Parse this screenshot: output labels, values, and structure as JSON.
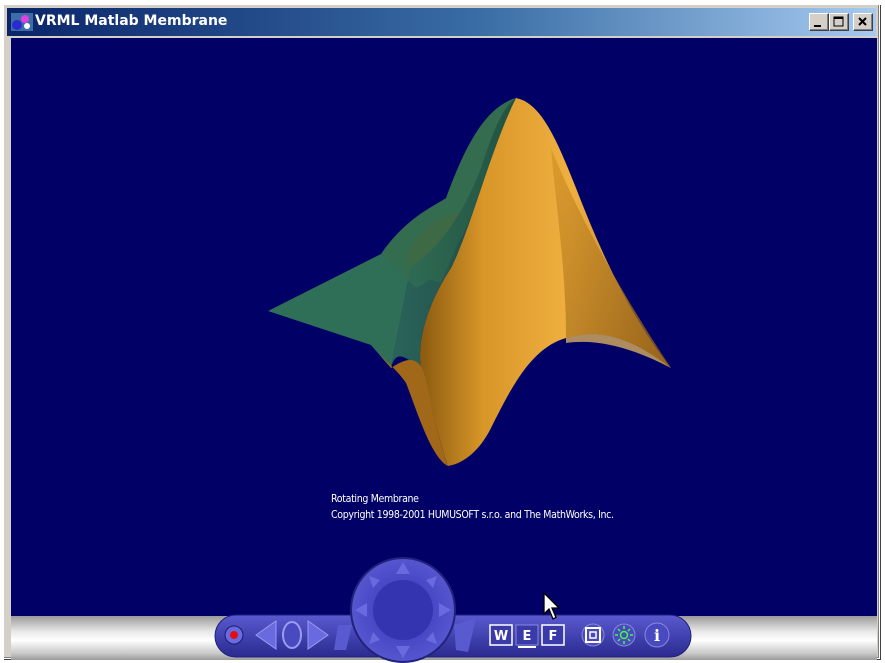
{
  "window": {
    "title": "VRML Matlab Membrane",
    "controls": [
      "minimize",
      "maximize",
      "close"
    ]
  },
  "scene": {
    "background_color": "#000066",
    "surface_color_light": "#e0a030",
    "surface_color_dark": "#2c6b55",
    "caption_line1": "Rotating Membrane",
    "caption_line2": "Copyright 1998-2001 HUMUSOFT s.r.o. and The MathWorks, Inc."
  },
  "navigation_panel": {
    "panel_color": "#3e3fb5",
    "buttons": [
      {
        "name": "record-button",
        "icon": "record-dot-icon"
      },
      {
        "name": "previous-viewpoint-button",
        "icon": "arrow-left-icon"
      },
      {
        "name": "default-viewpoint-button",
        "icon": "ellipse-icon"
      },
      {
        "name": "next-viewpoint-button",
        "icon": "arrow-right-icon"
      },
      {
        "name": "navigation-wheel",
        "icon": "compass-arrows-icon"
      },
      {
        "name": "walk-mode-button",
        "label": "W"
      },
      {
        "name": "examine-mode-button",
        "label": "E"
      },
      {
        "name": "fly-mode-button",
        "label": "F"
      },
      {
        "name": "straighten-button",
        "icon": "square-frames-icon"
      },
      {
        "name": "headlight-button",
        "icon": "light-bulb-icon"
      },
      {
        "name": "info-button",
        "label": "i"
      }
    ],
    "walk_label": "W",
    "examine_label": "E",
    "fly_label": "F",
    "info_label": "i"
  }
}
